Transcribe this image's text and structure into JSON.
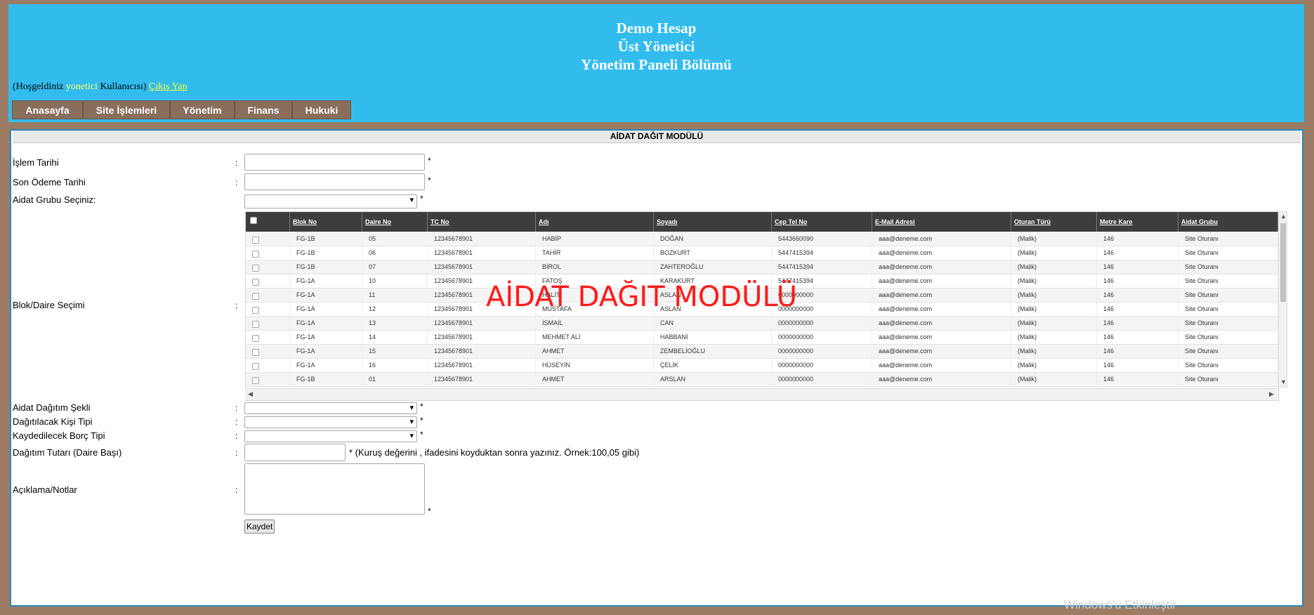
{
  "header": {
    "title_lines": [
      "Demo Hesap",
      "Üst Yönetici",
      "Yönetim Paneli Bölümü"
    ],
    "welcome_prefix": "(Hoşgeldiniz",
    "welcome_user": "yonetici",
    "welcome_suffix": "Kullanıcısı)",
    "logout": "Çıkış Yap",
    "nav": [
      "Anasayfa",
      "Site İşlemleri",
      "Yönetim",
      "Finans",
      "Hukuki"
    ]
  },
  "panel": {
    "title": "AİDAT DAĞIT MODÜLÜ",
    "watermark": "AİDAT DAĞIT MODÜLÜ",
    "colon": ":",
    "star": "*",
    "labels": {
      "islem_tarihi": "İşlem Tarihi",
      "son_odeme": "Son Ödeme Tarihi",
      "aidat_grubu": "Aidat Grubu Seçiniz:",
      "blok_daire": "Blok/Daire Seçimi",
      "dagitim_sekli": "Aidat Dağıtım Şekli",
      "dagitilacak_kisi": "Dağıtılacak Kişi Tipi",
      "borc_tipi": "Kaydedilecek Borç Tipi",
      "dagitim_tutari": "Dağıtım Tutarı (Daire Başı)",
      "aciklama": "Açıklama/Notlar"
    },
    "tutar_note": "* (Kuruş değerini , ifadesini koyduktan sonra yazınız. Örnek:100,05 gibi)",
    "save_label": "Kaydet"
  },
  "table": {
    "columns": [
      "Blok No",
      "Daire No",
      "TC No",
      "Adı",
      "Soyadı",
      "Cep Tel No",
      "E-Mail Adresi",
      "Oturan Türü",
      "Metre Kare",
      "Aidat Grubu"
    ],
    "rows": [
      [
        "FG-1B",
        "05",
        "12345678901",
        "HABİP",
        "DOĞAN",
        "5443660090",
        "aaa@deneme.com",
        "(Malik)",
        "146",
        "Site Oturanı"
      ],
      [
        "FG-1B",
        "06",
        "12345678901",
        "TAHİR",
        "BOZKURT",
        "5447415394",
        "aaa@deneme.com",
        "(Malik)",
        "146",
        "Site Oturanı"
      ],
      [
        "FG-1B",
        "07",
        "12345678901",
        "BİROL",
        "ZAHTEROĞLU",
        "5447415394",
        "aaa@deneme.com",
        "(Malik)",
        "146",
        "Site Oturanı"
      ],
      [
        "FG-1A",
        "10",
        "12345678901",
        "FATOŞ",
        "KARAKURT",
        "5447415394",
        "aaa@deneme.com",
        "(Malik)",
        "146",
        "Site Oturanı"
      ],
      [
        "FG-1A",
        "11",
        "12345678901",
        "HALİT",
        "ASLAN",
        "0000000000",
        "aaa@deneme.com",
        "(Malik)",
        "146",
        "Site Oturanı"
      ],
      [
        "FG-1A",
        "12",
        "12345678901",
        "MUSTAFA",
        "ASLAN",
        "0000000000",
        "aaa@deneme.com",
        "(Malik)",
        "146",
        "Site Oturanı"
      ],
      [
        "FG-1A",
        "13",
        "12345678901",
        "İSMAİL",
        "CAN",
        "0000000000",
        "aaa@deneme.com",
        "(Malik)",
        "146",
        "Site Oturanı"
      ],
      [
        "FG-1A",
        "14",
        "12345678901",
        "MEHMET ALİ",
        "HABBANİ",
        "0000000000",
        "aaa@deneme.com",
        "(Malik)",
        "146",
        "Site Oturanı"
      ],
      [
        "FG-1A",
        "15",
        "12345678901",
        "AHMET",
        "ZEMBELİOĞLU",
        "0000000000",
        "aaa@deneme.com",
        "(Malik)",
        "146",
        "Site Oturanı"
      ],
      [
        "FG-1A",
        "16",
        "12345678901",
        "HÜSEYİN",
        "ÇELİK",
        "0000000000",
        "aaa@deneme.com",
        "(Malik)",
        "146",
        "Site Oturanı"
      ],
      [
        "FG-1B",
        "01",
        "12345678901",
        "AHMET",
        "ARSLAN",
        "0000000000",
        "aaa@deneme.com",
        "(Malik)",
        "146",
        "Site Oturanı"
      ]
    ]
  },
  "os": {
    "activation_watermark": "Windows'u Etkinleştir"
  },
  "colors": {
    "header_bg": "#32bcee",
    "nav_bg": "#8a6e5c",
    "page_bg": "#9b7b63",
    "watermark": "#ff1b1b"
  }
}
